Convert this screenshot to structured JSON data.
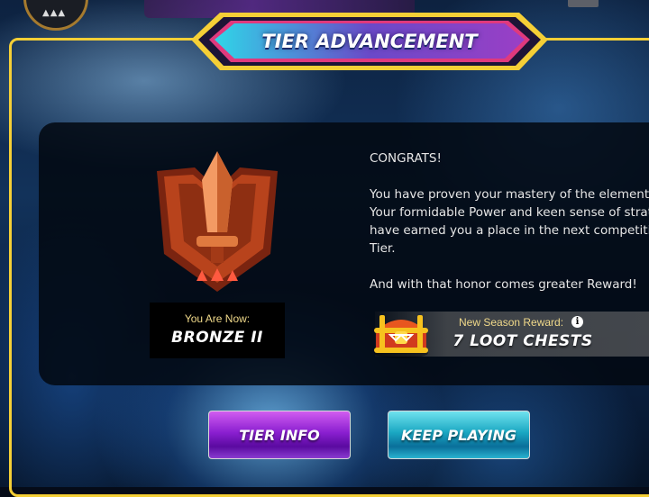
{
  "title": {
    "text": "TIER ADVANCEMENT"
  },
  "rank": {
    "caption": "You Are Now:",
    "name": "BRONZE II"
  },
  "message": {
    "heading": "CONGRATS!",
    "paragraph1_lines": [
      "You have proven your mastery of the elements.",
      "Your formidable Power and keen sense of strategy",
      "have earned you a place in the next competitive",
      "Tier."
    ],
    "paragraph2": "And with that honor comes greater Reward!"
  },
  "reward": {
    "caption": "New Season Reward:",
    "value": "7 LOOT CHESTS",
    "info_icon": "i"
  },
  "buttons": {
    "tier_info": "TIER INFO",
    "keep_playing": "KEEP PLAYING"
  },
  "colors": {
    "frame": "#f5cf36",
    "tier_info": "#8a1fd0",
    "keep_playing": "#1aa7c2",
    "badge": "#b8431c"
  }
}
